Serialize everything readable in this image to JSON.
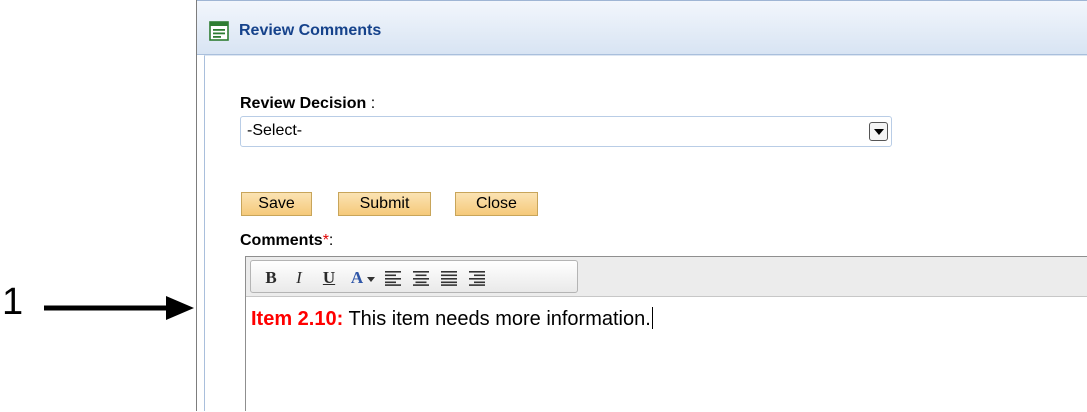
{
  "callout": {
    "number": "1"
  },
  "panel": {
    "title": "Review Comments"
  },
  "review_decision": {
    "label": "Review Decision",
    "separator": " :",
    "selected": "-Select-"
  },
  "buttons": {
    "save": "Save",
    "submit": "Submit",
    "close": "Close"
  },
  "comments": {
    "label": "Comments",
    "required_mark": "*",
    "separator": ":",
    "item_ref": "Item 2.10:",
    "text": " This item needs more information."
  },
  "toolbar": {
    "bold": "B",
    "italic": "I",
    "underline": "U",
    "font_color": "A"
  },
  "colors": {
    "header_title": "#15428b",
    "required": "#e00000",
    "item_ref": "#ff0000",
    "button_bg": "#f5c97a"
  },
  "icons": [
    "form-icon",
    "dropdown-arrow-icon",
    "font-color-dropdown-icon",
    "align-left-icon",
    "align-center-icon",
    "align-justify-icon",
    "align-right-icon",
    "arrow-icon"
  ]
}
